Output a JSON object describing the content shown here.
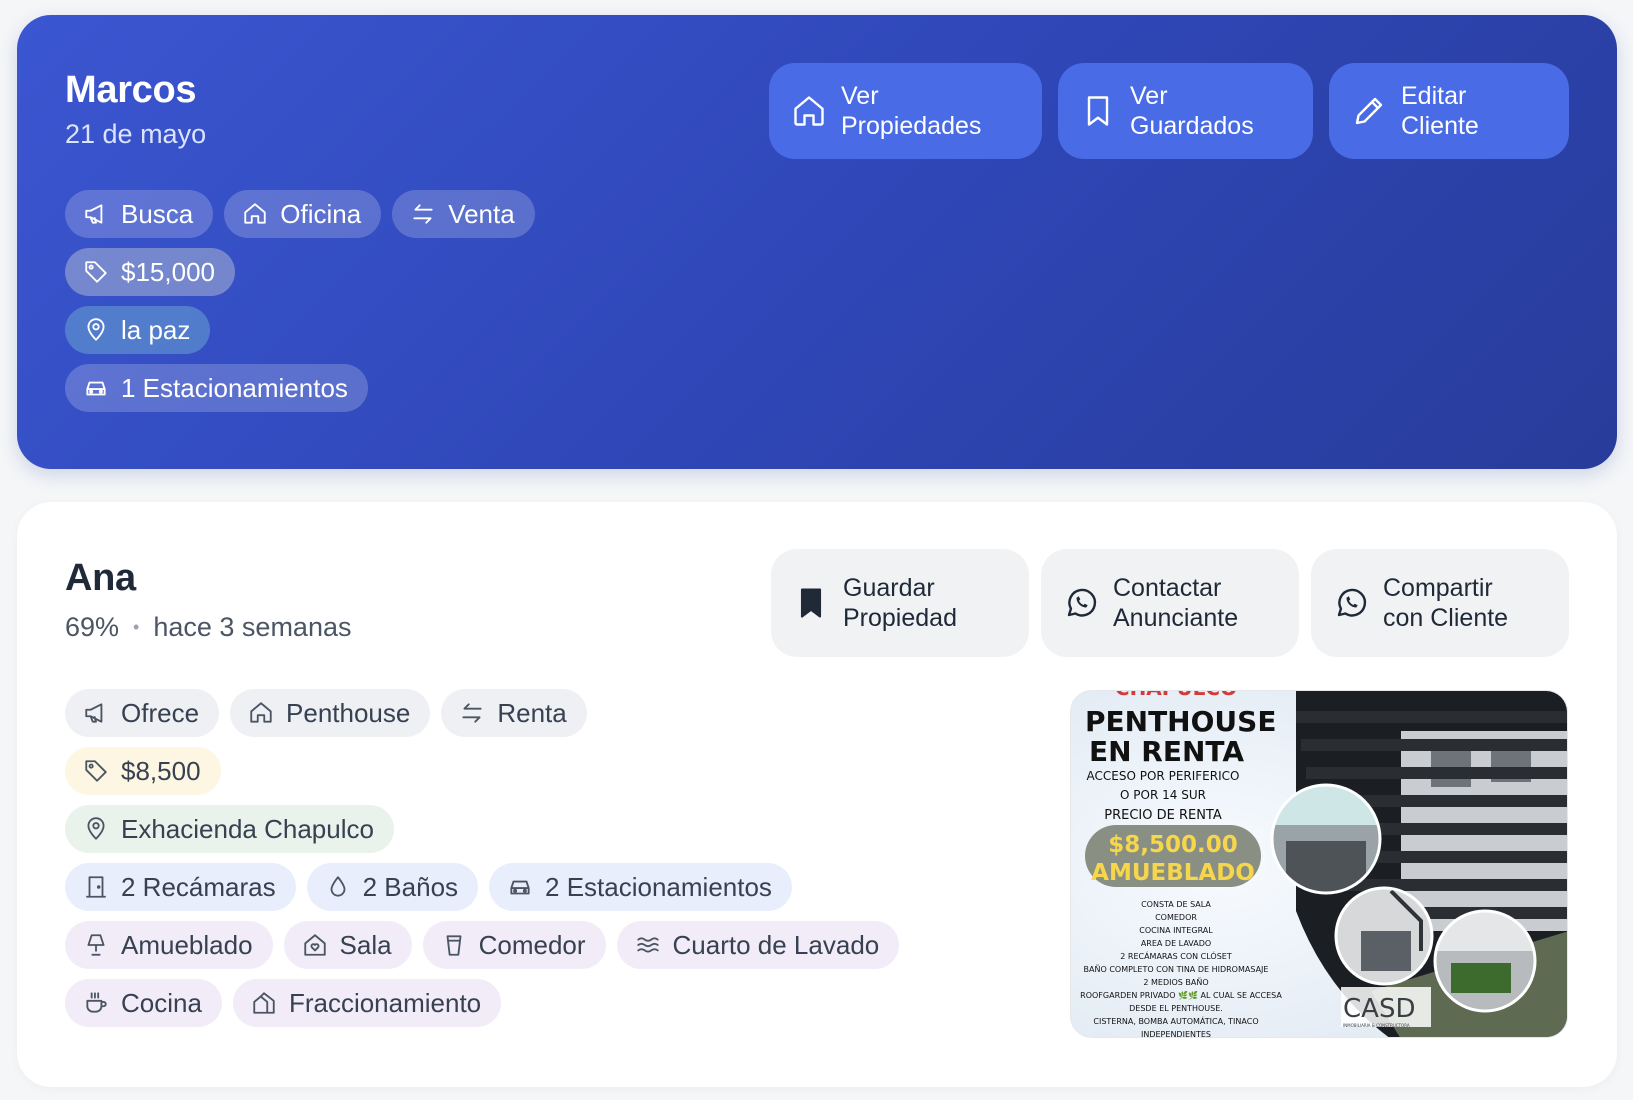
{
  "client": {
    "name": "Marcos",
    "date": "21 de mayo",
    "actions": [
      {
        "label": "Ver\nPropiedades",
        "icon": "home-icon"
      },
      {
        "label": "Ver\nGuardados",
        "icon": "bookmark-icon"
      },
      {
        "label": "Editar\nCliente",
        "icon": "pencil-icon"
      }
    ],
    "chips": {
      "intent": "Busca",
      "type": "Oficina",
      "operation": "Venta",
      "price": "$15,000",
      "location": "la paz",
      "parking": "1 Estacionamientos"
    }
  },
  "property": {
    "owner": "Ana",
    "match": "69%",
    "separator": "•",
    "posted": "hace 3 semanas",
    "actions": [
      {
        "label": "Guardar\nPropiedad",
        "icon": "bookmark-filled-icon"
      },
      {
        "label": "Contactar\nAnunciante",
        "icon": "whatsapp-icon"
      },
      {
        "label": "Compartir\ncon Cliente",
        "icon": "whatsapp-icon"
      }
    ],
    "chips": {
      "intent": "Ofrece",
      "type": "Penthouse",
      "operation": "Renta",
      "price": "$8,500",
      "location": "Exhacienda Chapulco",
      "bedrooms": "2 Recámaras",
      "bathrooms": "2 Baños",
      "parking": "2 Estacionamientos",
      "amenities": [
        "Amueblado",
        "Sala",
        "Comedor",
        "Cuarto de Lavado",
        "Cocina",
        "Fraccionamiento"
      ]
    },
    "flyer": {
      "header_cut": "CHAPULCO",
      "title_line1": "PENTHOUSE",
      "title_line2": "EN RENTA",
      "access1": "ACCESO POR PERIFERICO",
      "access2": "O POR 14 SUR",
      "price_label": "PRECIO DE RENTA",
      "price": "$8,500.00",
      "furnished": "AMUEBLADO",
      "details": [
        "CONSTA DE SALA",
        "COMEDOR",
        "COCINA INTEGRAL",
        "AREA DE LAVADO",
        "2 RECÁMARAS CON CLÓSET",
        "BAÑO COMPLETO CON TINA DE HIDROMASAJE",
        "2 MEDIOS BAÑO",
        "ROOFGARDEN PRIVADO 🌿🌿 AL CUAL SE ACCESA",
        "DESDE EL PENTHOUSE.",
        "CISTERNA, BOMBA AUTOMÁTICA, TINACO",
        "INDEPENDIENTES"
      ],
      "logo": "CASD",
      "logo_sub": "INMOBILIARIA & CONSTRUCTORA"
    }
  }
}
